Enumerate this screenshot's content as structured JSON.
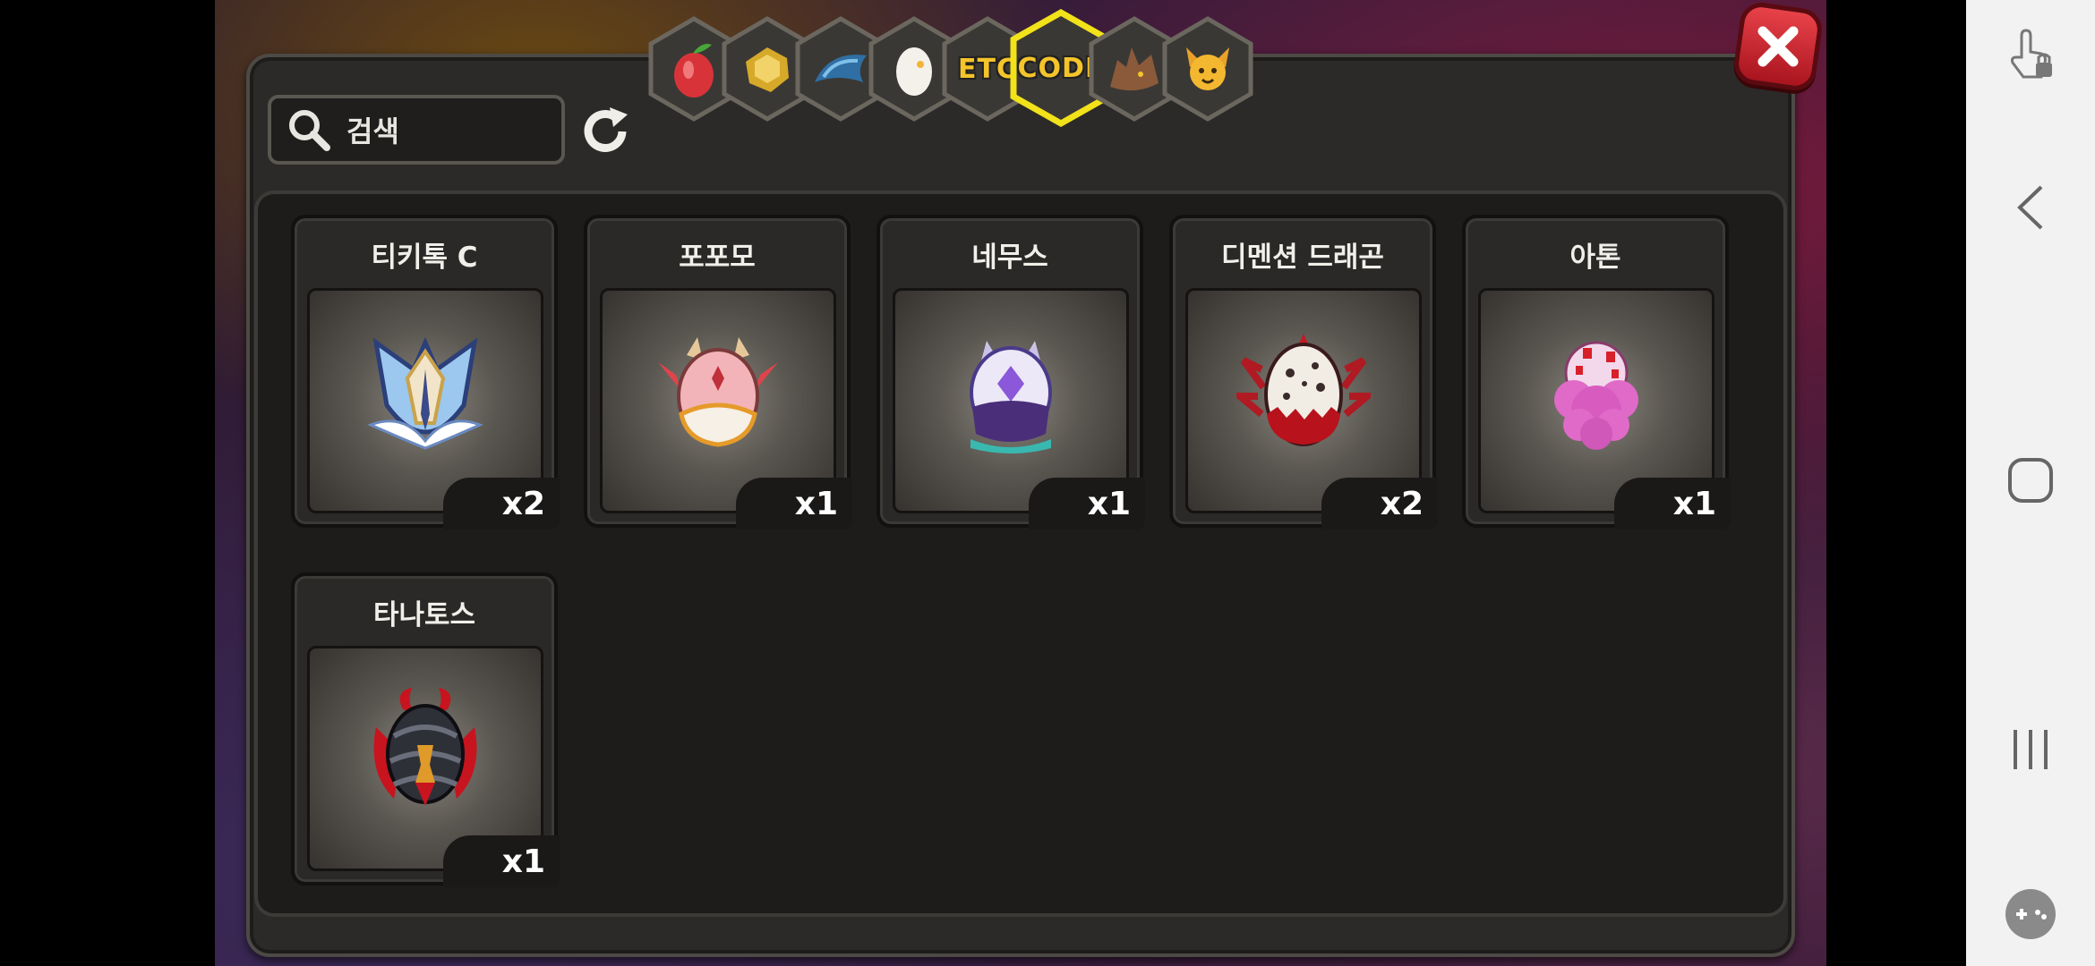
{
  "tabs": [
    {
      "name": "fruit",
      "icon": "fruit-icon",
      "label": ""
    },
    {
      "name": "material",
      "icon": "gold-material-icon",
      "label": ""
    },
    {
      "name": "dragon-part",
      "icon": "dragon-scale-icon",
      "label": ""
    },
    {
      "name": "egg",
      "icon": "egg-icon",
      "label": ""
    },
    {
      "name": "etc",
      "icon": "",
      "label": "ETC"
    },
    {
      "name": "code",
      "icon": "",
      "label": "CODE",
      "selected": true
    },
    {
      "name": "dragon",
      "icon": "dragon-head-icon",
      "label": ""
    },
    {
      "name": "pet",
      "icon": "pet-face-icon",
      "label": ""
    }
  ],
  "search": {
    "placeholder": "검색"
  },
  "items": [
    {
      "name": "티키톡 C",
      "count": "x2",
      "icon": "crest-egg-icon"
    },
    {
      "name": "포포모",
      "count": "x1",
      "icon": "pink-horned-egg-icon"
    },
    {
      "name": "네무스",
      "count": "x1",
      "icon": "purple-egg-icon"
    },
    {
      "name": "디멘션 드래곤",
      "count": "x2",
      "icon": "spotted-red-egg-icon"
    },
    {
      "name": "아톤",
      "count": "x1",
      "icon": "pink-fluffy-egg-icon"
    },
    {
      "name": "타나토스",
      "count": "x1",
      "icon": "dark-red-egg-icon"
    }
  ],
  "colors": {
    "accent": "#f5c42a",
    "close": "#d8303a",
    "panel": "#2b2a28"
  }
}
